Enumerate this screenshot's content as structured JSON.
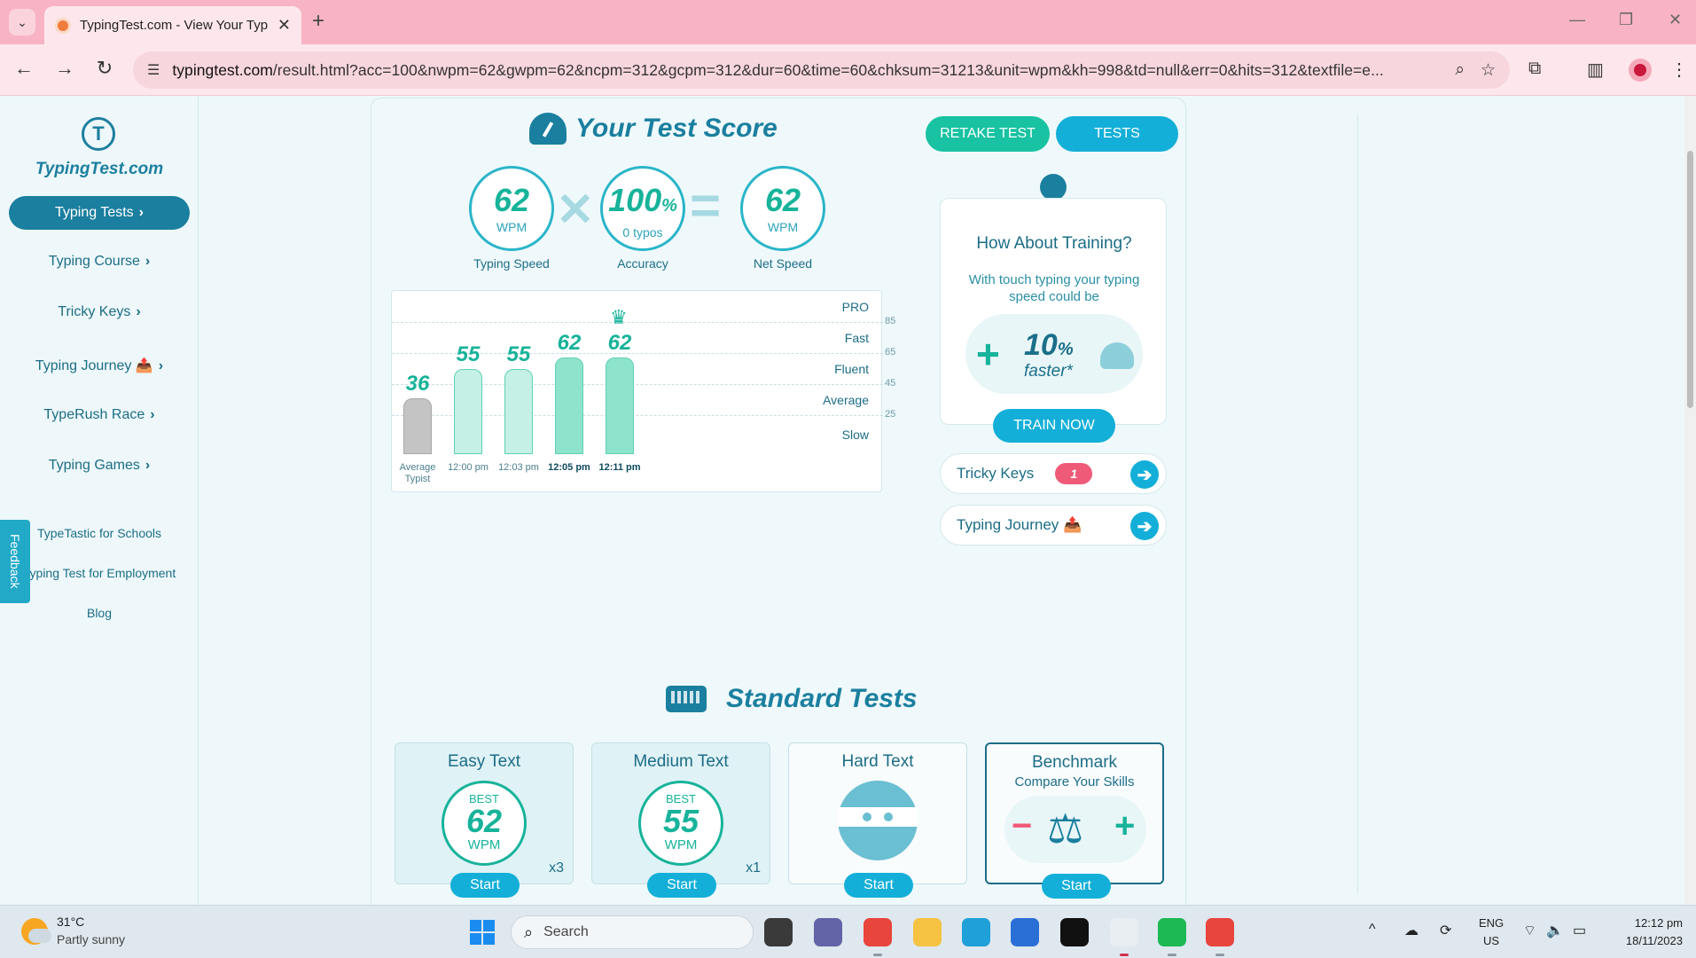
{
  "browser": {
    "tab_title": "TypingTest.com - View Your Typ",
    "url_domain": "typingtest.com",
    "url_path": "/result.html?acc=100&nwpm=62&gwpm=62&ncpm=312&gcpm=312&dur=60&time=60&chksum=31213&unit=wpm&kh=998&td=null&err=0&hits=312&textfile=e...",
    "icons": {
      "tab_list": "chevron-down-icon",
      "close_tab": "close-icon",
      "new_tab": "plus-icon",
      "back": "arrow-left-icon",
      "forward": "arrow-right-icon",
      "reload": "reload-icon",
      "site_info": "tune-icon",
      "zoom": "magnifier-icon",
      "bookmark": "star-icon",
      "extensions": "puzzle-icon",
      "side_panel": "side-panel-icon",
      "menu": "kebab-menu-icon"
    },
    "glyphs": {
      "tab_list": "⌄",
      "close_tab": "✕",
      "new_tab": "+",
      "minimize": "—",
      "restore": "❐",
      "close_window": "✕",
      "back": "←",
      "forward": "→",
      "reload": "↻",
      "site_info": "☰",
      "zoom": "⌕",
      "bookmark": "☆",
      "extensions": "⧉",
      "side_panel": "▥",
      "menu": "⋮"
    }
  },
  "sidebar": {
    "logo_mark": "T",
    "logo_text": "TypingTest.com",
    "active_item": "Typing Tests",
    "chevron": "›",
    "items": [
      {
        "label": "Typing Course"
      },
      {
        "label": "Tricky Keys"
      },
      {
        "label": "Typing Journey 📤"
      },
      {
        "label": "TypeRush Race"
      },
      {
        "label": "Typing Games"
      }
    ],
    "links": [
      "TypeTastic for Schools",
      "Typing Test for Employment",
      "Blog"
    ],
    "feedback": "Feedback"
  },
  "score": {
    "title": "Your Test Score",
    "retake_label": "RETAKE TEST",
    "tests_label": "TESTS",
    "times_sign": "✕",
    "equals_sign": "=",
    "typing_speed": {
      "value": "62",
      "unit": "WPM",
      "label": "Typing Speed"
    },
    "accuracy": {
      "value": "100",
      "percent": "%",
      "typos": "0  typos",
      "label": "Accuracy"
    },
    "net_speed": {
      "value": "62",
      "unit": "WPM",
      "label": "Net Speed"
    }
  },
  "chart_data": {
    "type": "bar",
    "categories": [
      "Average Typist",
      "12:00 pm",
      "12:03 pm",
      "12:05 pm",
      "12:11 pm"
    ],
    "values": [
      36,
      55,
      55,
      62,
      62
    ],
    "value_labels": [
      "36",
      "55",
      "55",
      "62",
      "62"
    ],
    "bold_categories": [
      false,
      false,
      false,
      true,
      true
    ],
    "highlight_best_index": 4,
    "crown": "♛",
    "levels": [
      "PRO",
      "Fast",
      "Fluent",
      "Average",
      "Slow"
    ],
    "tick_labels": [
      "85",
      "65",
      "45",
      "25"
    ],
    "ylim": [
      0,
      105
    ],
    "colors": {
      "average": "#c4c4c4",
      "early": "#c5f0e5",
      "recent": "#8ee3cc"
    },
    "grid": true
  },
  "training": {
    "title": "How About Training?",
    "description": "With touch typing your typing speed could be",
    "plus": "+",
    "percent": "10",
    "percent_sign": "%",
    "faster": "faster*",
    "button_label": "TRAIN NOW",
    "bulb_icon": "lightbulb-icon"
  },
  "quick_links": {
    "tricky_keys_label": "Tricky Keys",
    "tricky_keys_count": "1",
    "typing_journey_label": "Typing Journey 📤",
    "arrow": "➔"
  },
  "standard_tests": {
    "title": "Standard Tests",
    "cards": [
      {
        "title": "Easy Text",
        "best_label": "BEST",
        "best_value": "62",
        "best_unit": "WPM",
        "attempts": "x3",
        "start": "Start"
      },
      {
        "title": "Medium Text",
        "best_label": "BEST",
        "best_value": "55",
        "best_unit": "WPM",
        "attempts": "x1",
        "start": "Start"
      },
      {
        "title": "Hard Text",
        "start": "Start"
      },
      {
        "title": "Benchmark",
        "subtitle": "Compare Your Skills",
        "start": "Start",
        "minus": "−",
        "scale": "⚖",
        "plus": "+"
      }
    ]
  },
  "taskbar": {
    "weather_temp": "31°C",
    "weather_desc": "Partly sunny",
    "search_placeholder": "Search",
    "search_glyph": "⌕",
    "tray_chevron": "^",
    "tray_glyphs": {
      "cloud": "☁",
      "sync": "⟳",
      "wifi": "⌔",
      "volume": "🔈",
      "battery": "▭"
    },
    "lang_1": "ENG",
    "lang_2": "US",
    "time": "12:12 pm",
    "date": "18/11/2023",
    "apps": [
      {
        "name": "task-view-app",
        "color": "#3a3a3a"
      },
      {
        "name": "teams-app",
        "color": "#6264a7"
      },
      {
        "name": "chrome-app",
        "color": "#e8453c"
      },
      {
        "name": "file-explorer-app",
        "color": "#f5c242"
      },
      {
        "name": "edge-app",
        "color": "#1fa0d8"
      },
      {
        "name": "store-app",
        "color": "#2a6fd6"
      },
      {
        "name": "netflix-app",
        "color": "#111111"
      },
      {
        "name": "snipping-tool-app",
        "color": "#e9eef2"
      },
      {
        "name": "spotify-app",
        "color": "#1db954"
      },
      {
        "name": "chrome-profile-app",
        "color": "#e8453c"
      }
    ]
  }
}
